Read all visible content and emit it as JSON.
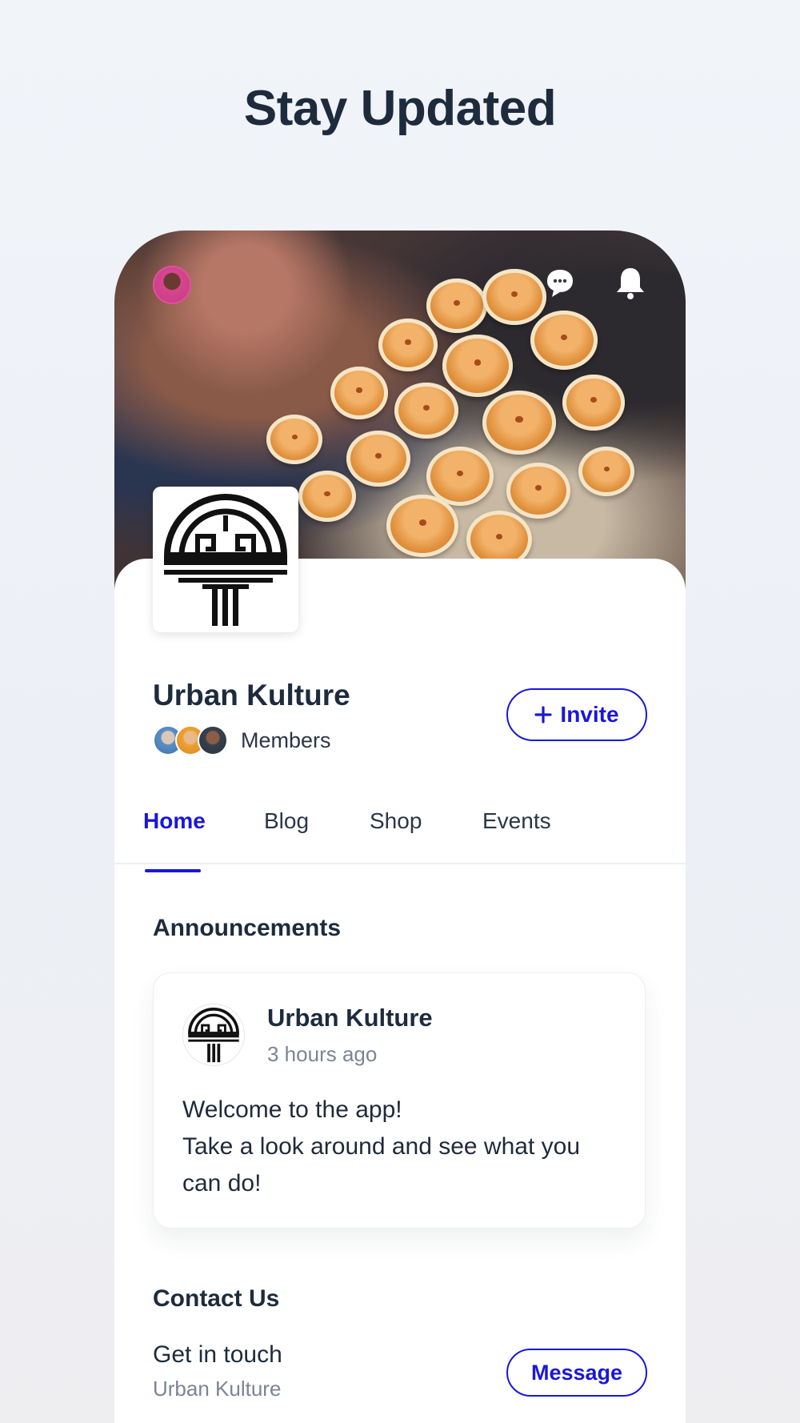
{
  "headline": "Stay Updated",
  "group": {
    "name": "Urban Kulture",
    "members_label": "Members",
    "invite_label": "Invite"
  },
  "tabs": [
    {
      "label": "Home",
      "active": true
    },
    {
      "label": "Blog",
      "active": false
    },
    {
      "label": "Shop",
      "active": false
    },
    {
      "label": "Events",
      "active": false
    }
  ],
  "announcements": {
    "title": "Announcements",
    "post": {
      "author": "Urban Kulture",
      "time": "3 hours ago",
      "lines": [
        "Welcome to the app!",
        "Take a look around and see what you",
        "can do!"
      ]
    }
  },
  "contact": {
    "title": "Contact Us",
    "main": "Get in touch",
    "sub": "Urban Kulture",
    "button": "Message"
  },
  "icons": {
    "chat": "chat-bubble-icon",
    "bell": "bell-icon",
    "plus": "plus-icon"
  },
  "colors": {
    "accent": "#1a17d9",
    "heading": "#1d2b3d",
    "muted": "#7c8493"
  }
}
